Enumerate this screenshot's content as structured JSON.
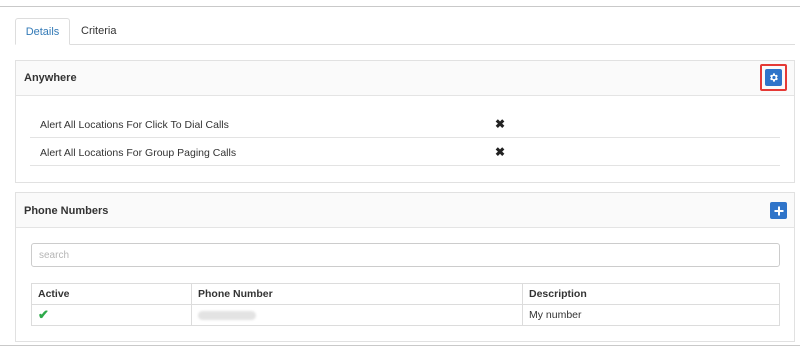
{
  "tabs": [
    {
      "label": "Details",
      "active": true
    },
    {
      "label": "Criteria",
      "active": false
    }
  ],
  "anywhere": {
    "title": "Anywhere",
    "settings_button_icon": "gear-icon",
    "settings": [
      {
        "label": "Alert All Locations For Click To Dial Calls",
        "value": "✖"
      },
      {
        "label": "Alert All Locations For Group Paging Calls",
        "value": "✖"
      }
    ]
  },
  "phone_numbers": {
    "title": "Phone Numbers",
    "add_button_icon": "plus-icon",
    "search": {
      "placeholder": "search",
      "value": ""
    },
    "table": {
      "headers": [
        "Active",
        "Phone Number",
        "Description"
      ],
      "rows": [
        {
          "active": "✔",
          "phone_number": "",
          "description": "My number"
        }
      ]
    }
  },
  "colors": {
    "accent": "#2f74c9",
    "highlight": "#e53935",
    "success": "#2eaa4a"
  }
}
